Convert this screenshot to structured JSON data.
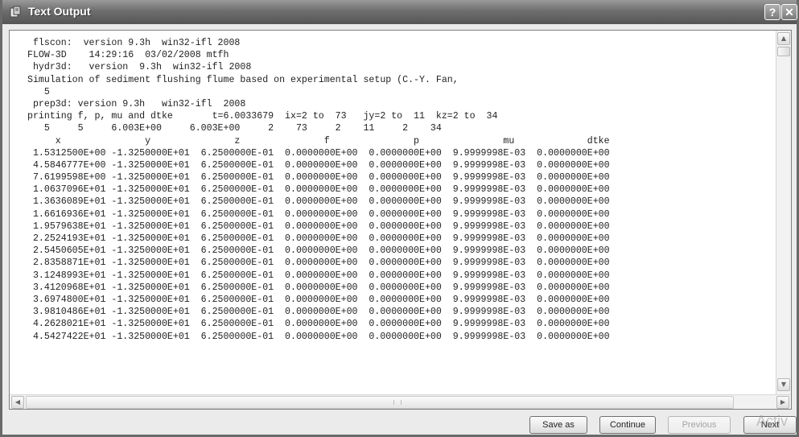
{
  "window": {
    "title": "Text Output",
    "help_label": "?",
    "close_label": "✕"
  },
  "output_lines": [
    " flscon:  version 9.3h  win32-ifl 2008",
    "FLOW-3D    14:29:16  03/02/2008 mtfh",
    " hydr3d:   version  9.3h  win32-ifl 2008",
    "Simulation of sediment flushing flume based on experimental setup (C.-Y. Fan,",
    "   5",
    " prep3d: version 9.3h   win32-ifl  2008",
    "printing f, p, mu and dtke       t=6.0033679  ix=2 to  73   jy=2 to  11  kz=2 to  34",
    "   5     5     6.003E+00     6.003E+00     2    73     2    11     2    34",
    "     x               y               z               f               p               mu             dtke",
    " 1.5312500E+00 -1.3250000E+01  6.2500000E-01  0.0000000E+00  0.0000000E+00  9.9999998E-03  0.0000000E+00",
    " 4.5846777E+00 -1.3250000E+01  6.2500000E-01  0.0000000E+00  0.0000000E+00  9.9999998E-03  0.0000000E+00",
    " 7.6199598E+00 -1.3250000E+01  6.2500000E-01  0.0000000E+00  0.0000000E+00  9.9999998E-03  0.0000000E+00",
    " 1.0637096E+01 -1.3250000E+01  6.2500000E-01  0.0000000E+00  0.0000000E+00  9.9999998E-03  0.0000000E+00",
    " 1.3636089E+01 -1.3250000E+01  6.2500000E-01  0.0000000E+00  0.0000000E+00  9.9999998E-03  0.0000000E+00",
    " 1.6616936E+01 -1.3250000E+01  6.2500000E-01  0.0000000E+00  0.0000000E+00  9.9999998E-03  0.0000000E+00",
    " 1.9579638E+01 -1.3250000E+01  6.2500000E-01  0.0000000E+00  0.0000000E+00  9.9999998E-03  0.0000000E+00",
    " 2.2524193E+01 -1.3250000E+01  6.2500000E-01  0.0000000E+00  0.0000000E+00  9.9999998E-03  0.0000000E+00",
    " 2.5450605E+01 -1.3250000E+01  6.2500000E-01  0.0000000E+00  0.0000000E+00  9.9999998E-03  0.0000000E+00",
    " 2.8358871E+01 -1.3250000E+01  6.2500000E-01  0.0000000E+00  0.0000000E+00  9.9999998E-03  0.0000000E+00",
    " 3.1248993E+01 -1.3250000E+01  6.2500000E-01  0.0000000E+00  0.0000000E+00  9.9999998E-03  0.0000000E+00",
    " 3.4120968E+01 -1.3250000E+01  6.2500000E-01  0.0000000E+00  0.0000000E+00  9.9999998E-03  0.0000000E+00",
    " 3.6974800E+01 -1.3250000E+01  6.2500000E-01  0.0000000E+00  0.0000000E+00  9.9999998E-03  0.0000000E+00",
    " 3.9810486E+01 -1.3250000E+01  6.2500000E-01  0.0000000E+00  0.0000000E+00  9.9999998E-03  0.0000000E+00",
    " 4.2628021E+01 -1.3250000E+01  6.2500000E-01  0.0000000E+00  0.0000000E+00  9.9999998E-03  0.0000000E+00",
    " 4.5427422E+01 -1.3250000E+01  6.2500000E-01  0.0000000E+00  0.0000000E+00  9.9999998E-03  0.0000000E+00"
  ],
  "buttons": {
    "save_as": "Save as",
    "continue": "Continue",
    "previous": "Previous",
    "next": "Next"
  },
  "watermark": "Activ",
  "icons": {
    "window_icon": "app-window-icon",
    "scroll_up": "scroll-up-icon",
    "scroll_down": "scroll-down-icon",
    "scroll_left": "scroll-left-icon",
    "scroll_right": "scroll-right-icon"
  },
  "colors": {
    "title_bar": "#6e6e6e",
    "text": "#222222",
    "disabled_text": "#a3a3a3"
  }
}
